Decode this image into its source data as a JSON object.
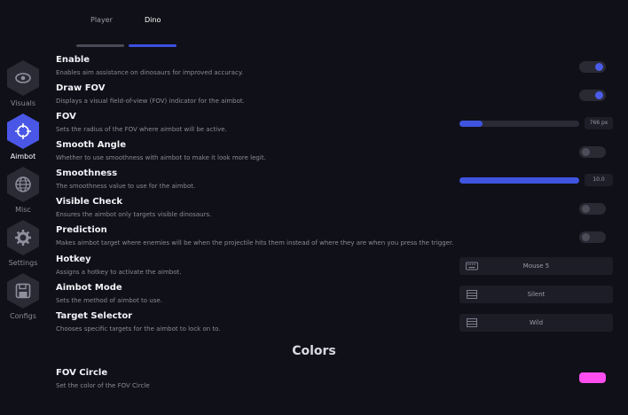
{
  "tabs": [
    {
      "label": "Player",
      "active": false
    },
    {
      "label": "Dino",
      "active": true
    }
  ],
  "sidebar": {
    "items": [
      {
        "label": "Visuals",
        "icon": "eye-icon",
        "active": false
      },
      {
        "label": "Aimbot",
        "icon": "crosshair-icon",
        "active": true
      },
      {
        "label": "Misc",
        "icon": "globe-icon",
        "active": false
      },
      {
        "label": "Settings",
        "icon": "gear-icon",
        "active": false
      },
      {
        "label": "Configs",
        "icon": "save-icon",
        "active": false
      }
    ]
  },
  "settings": {
    "enable": {
      "title": "Enable",
      "desc": "Enables aim assistance on dinosaurs for improved accuracy.",
      "on": true
    },
    "draw_fov": {
      "title": "Draw FOV",
      "desc": "Displays a visual field-of-view (FOV) indicator for the aimbot.",
      "on": true
    },
    "fov": {
      "title": "FOV",
      "desc": "Sets the radius of the FOV where aimbot will be active.",
      "value": "766 px",
      "fraction": 0.19
    },
    "smooth_angle": {
      "title": "Smooth Angle",
      "desc": "Whether to use smoothness with aimbot to make it look more legit.",
      "on": false
    },
    "smoothness": {
      "title": "Smoothness",
      "desc": "The smoothness value to use for the aimbot.",
      "value": "10.0",
      "fraction": 1.0
    },
    "visible_check": {
      "title": "Visible Check",
      "desc": "Ensures the aimbot only targets visible dinosaurs.",
      "on": false
    },
    "prediction": {
      "title": "Prediction",
      "desc": "Makes aimbot target where enemies will be when the projectile hits them instead of where they are when you press the trigger.",
      "on": false
    },
    "hotkey": {
      "title": "Hotkey",
      "desc": "Assigns a hotkey to activate the aimbot.",
      "value": "Mouse 5"
    },
    "aimbot_mode": {
      "title": "Aimbot Mode",
      "desc": "Sets the method of aimbot to use.",
      "value": "Silent"
    },
    "target_selector": {
      "title": "Target Selector",
      "desc": "Chooses specific targets for the aimbot to lock on to.",
      "value": "Wild"
    }
  },
  "colors": {
    "section_title": "Colors",
    "fov_circle": {
      "title": "FOV Circle",
      "desc": "Set the color of the FOV Circle",
      "color": "#ff4df0"
    }
  },
  "theme": {
    "accent": "#4a5ce8",
    "background": "#101018"
  }
}
